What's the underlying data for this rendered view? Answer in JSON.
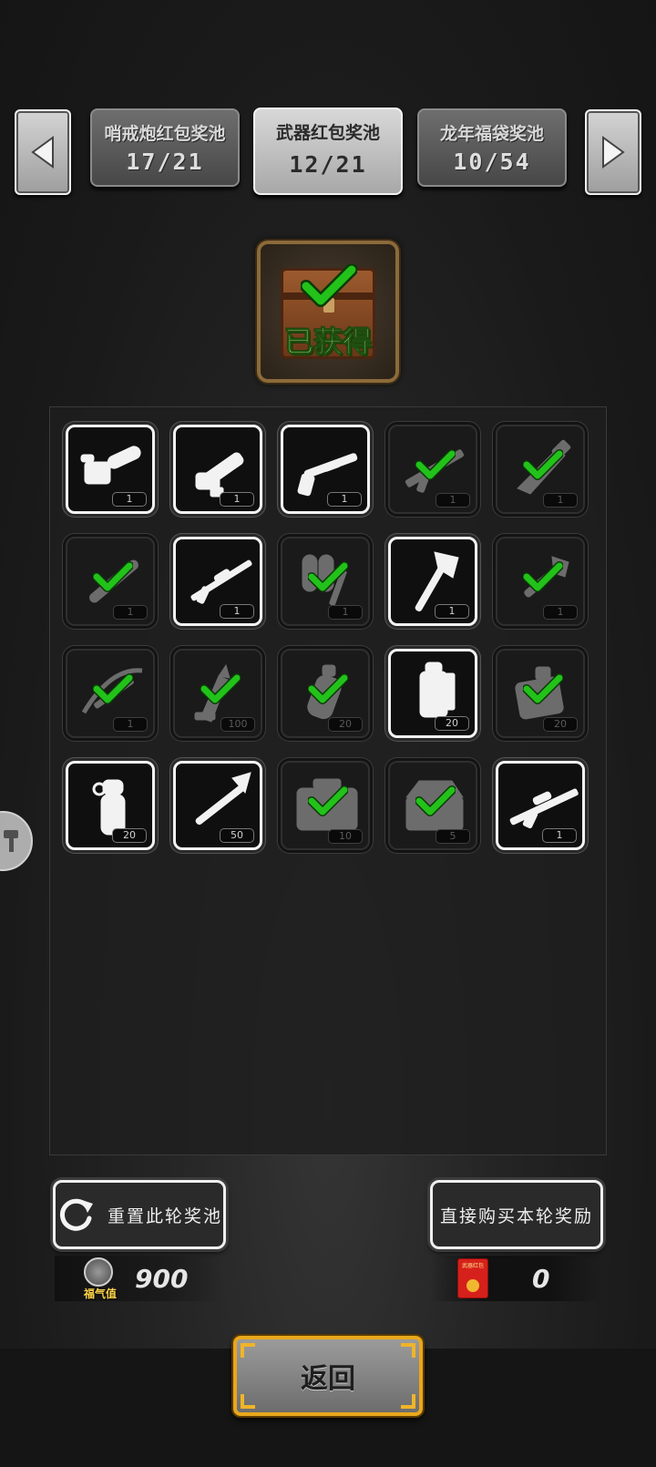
{
  "pools": [
    {
      "name": "哨戒炮红包奖池",
      "count": "17/21",
      "active": false
    },
    {
      "name": "武器红包奖池",
      "count": "12/21",
      "active": true
    },
    {
      "name": "龙年福袋奖池",
      "count": "10/54",
      "active": false
    }
  ],
  "status": {
    "label": "已获得",
    "icon": "treasure-chest-icon"
  },
  "rewards": [
    {
      "icon": "chainsaw",
      "qty": "1",
      "obtained": false
    },
    {
      "icon": "minigun",
      "qty": "1",
      "obtained": false
    },
    {
      "icon": "shotgun",
      "qty": "1",
      "obtained": false
    },
    {
      "icon": "assault-rifle",
      "qty": "1",
      "obtained": true
    },
    {
      "icon": "combat-knife",
      "qty": "1",
      "obtained": true
    },
    {
      "icon": "baton",
      "qty": "1",
      "obtained": true
    },
    {
      "icon": "sniper-rifle",
      "qty": "1",
      "obtained": false
    },
    {
      "icon": "flamethrower",
      "qty": "1",
      "obtained": true
    },
    {
      "icon": "fire-axe",
      "qty": "1",
      "obtained": false
    },
    {
      "icon": "shovel",
      "qty": "1",
      "obtained": true
    },
    {
      "icon": "crossbow",
      "qty": "1",
      "obtained": true
    },
    {
      "icon": "rocket-ammo",
      "qty": "100",
      "obtained": true
    },
    {
      "icon": "grenade",
      "qty": "20",
      "obtained": true
    },
    {
      "icon": "spiked-grenade",
      "qty": "20",
      "obtained": false
    },
    {
      "icon": "c4-explosive",
      "qty": "20",
      "obtained": true
    },
    {
      "icon": "frag-grenade",
      "qty": "20",
      "obtained": false
    },
    {
      "icon": "rpg-rocket",
      "qty": "50",
      "obtained": false
    },
    {
      "icon": "tool-case",
      "qty": "10",
      "obtained": true
    },
    {
      "icon": "toolbox",
      "qty": "5",
      "obtained": true
    },
    {
      "icon": "heavy-sniper",
      "qty": "1",
      "obtained": false
    }
  ],
  "actions": {
    "reset_label": "重置此轮奖池",
    "buy_label": "直接购买本轮奖励"
  },
  "currencies": {
    "luck": {
      "caption": "福气值",
      "amount": "900"
    },
    "red_packet": {
      "caption": "武器红包",
      "amount": "0"
    }
  },
  "back_label": "返回",
  "colors": {
    "check": "#22c21a",
    "accent_gold": "#e8a81c",
    "chest_label": "#b5f08a"
  }
}
